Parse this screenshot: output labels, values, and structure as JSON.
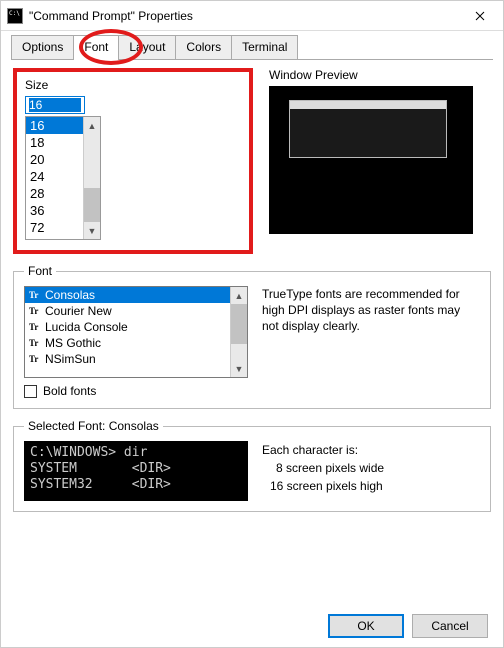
{
  "window": {
    "title": "\"Command Prompt\" Properties"
  },
  "tabs": {
    "options": "Options",
    "font": "Font",
    "layout": "Layout",
    "colors": "Colors",
    "terminal": "Terminal"
  },
  "size": {
    "label": "Size",
    "value": "16",
    "options": [
      "16",
      "18",
      "20",
      "24",
      "28",
      "36",
      "72"
    ]
  },
  "preview": {
    "label": "Window Preview"
  },
  "font": {
    "legend": "Font",
    "items": [
      "Consolas",
      "Courier New",
      "Lucida Console",
      "MS Gothic",
      "NSimSun"
    ],
    "desc": "TrueType fonts are recommended for high DPI displays as raster fonts may not display clearly.",
    "bold_label": "Bold fonts"
  },
  "selected": {
    "legend": "Selected Font: Consolas",
    "sample_l1": "C:\\WINDOWS> dir",
    "sample_l2": "SYSTEM       <DIR>",
    "sample_l3": "SYSTEM32     <DIR>",
    "char_intro": "Each character is:",
    "char_w": "8 screen pixels wide",
    "char_h": "16 screen pixels high"
  },
  "buttons": {
    "ok": "OK",
    "cancel": "Cancel"
  }
}
